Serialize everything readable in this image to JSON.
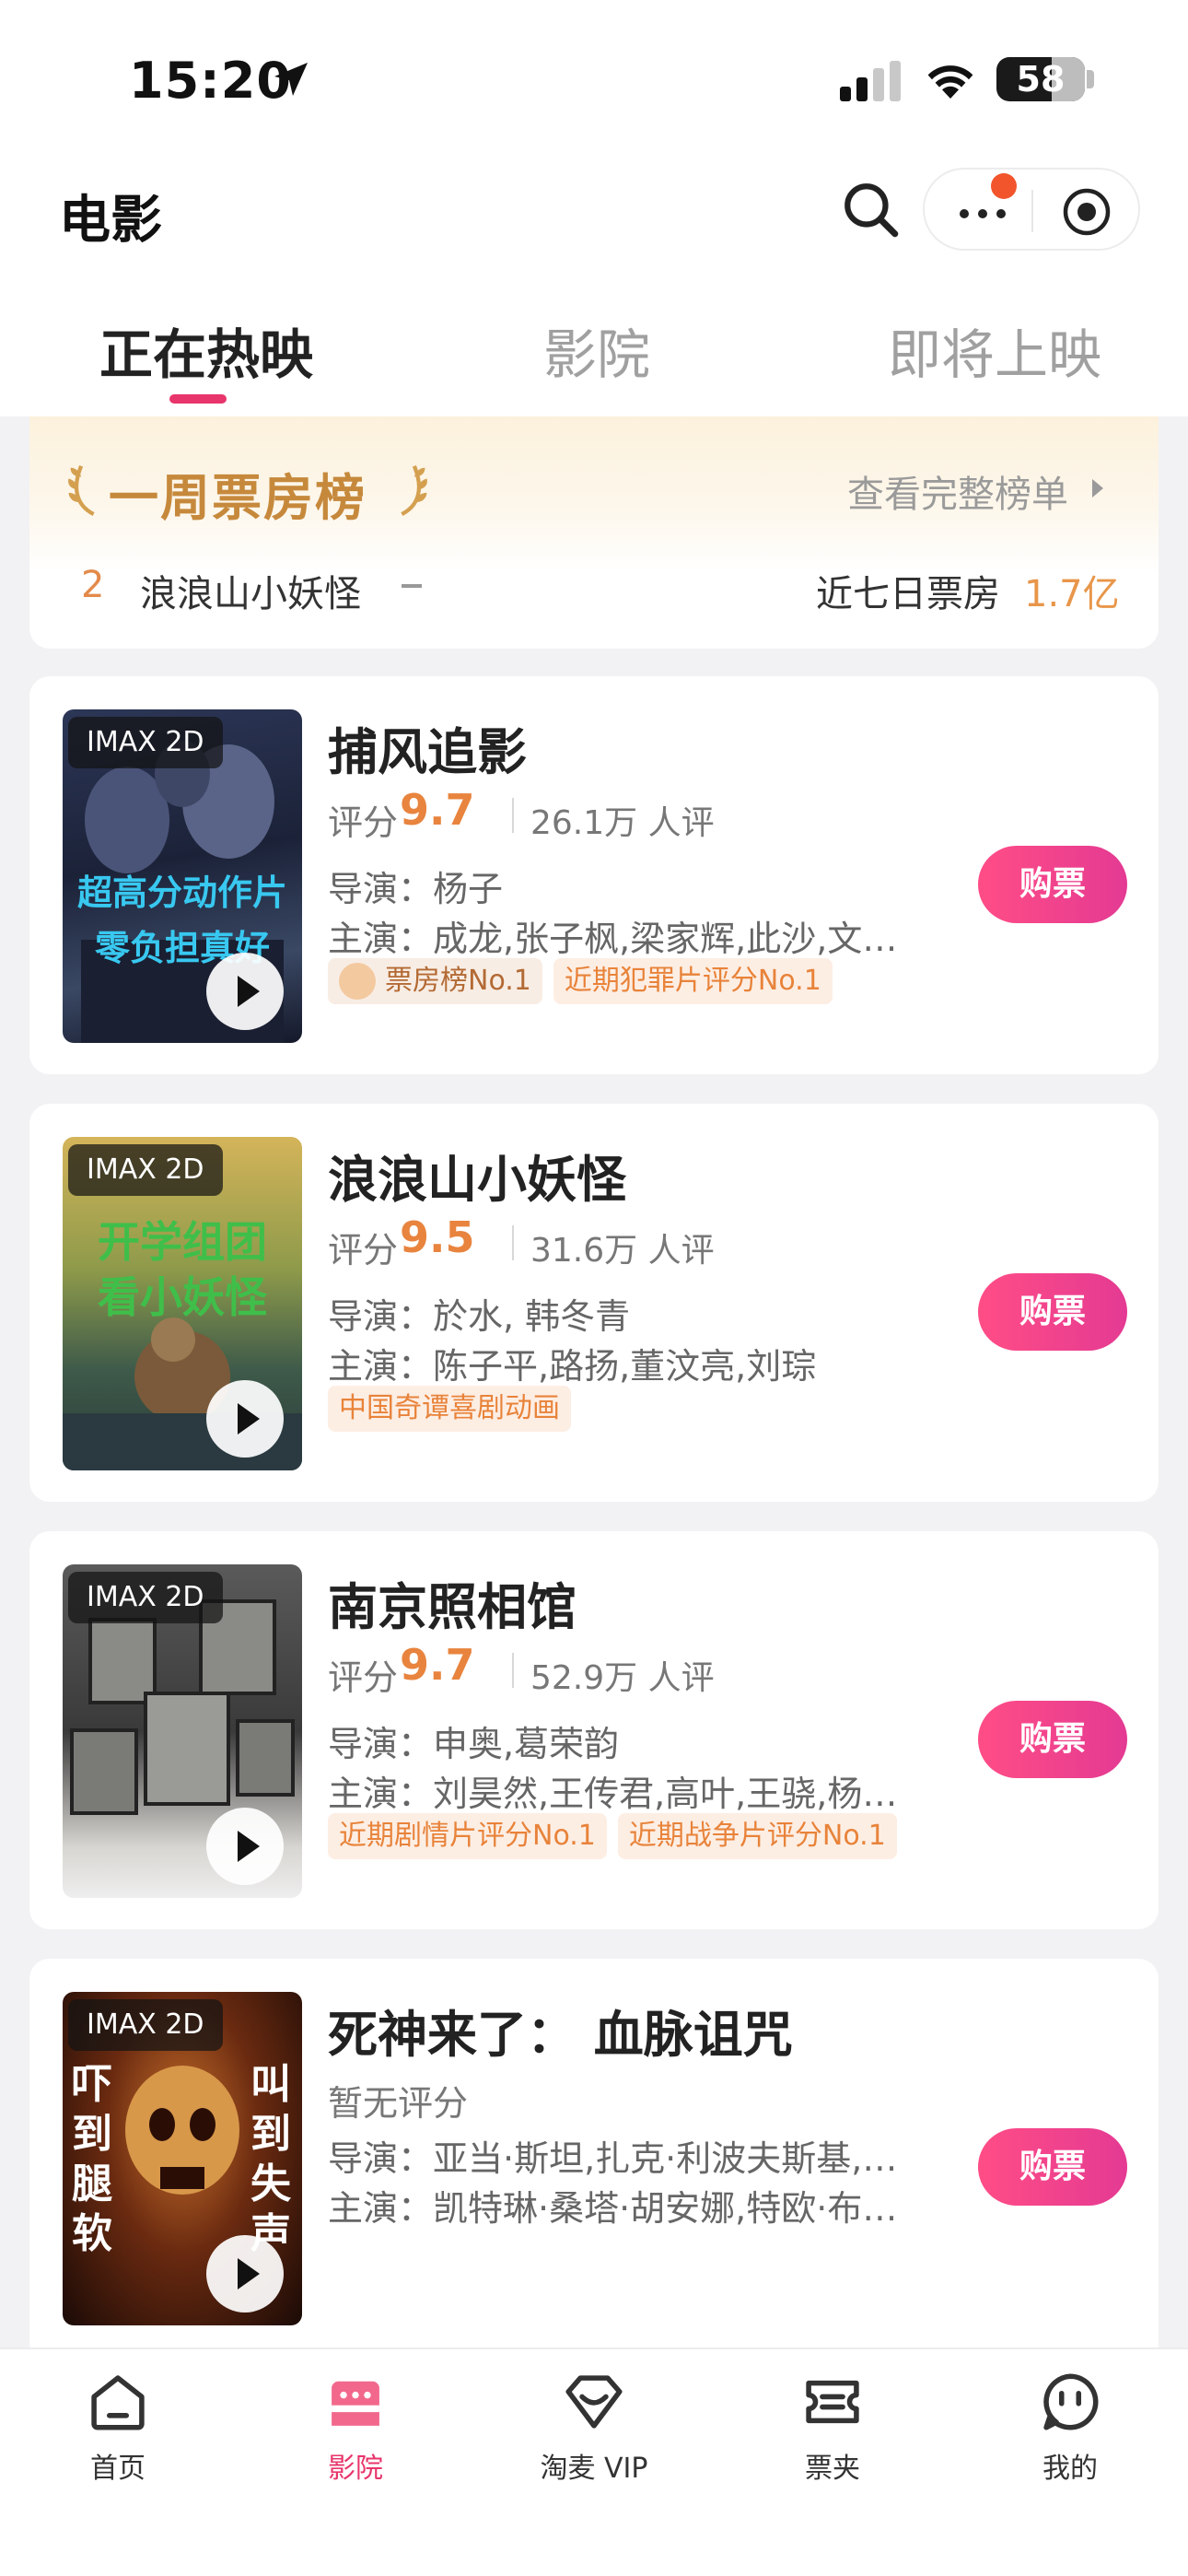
{
  "status_bar": {
    "time": "15:20",
    "battery": "58"
  },
  "header": {
    "title": "电影"
  },
  "tabs": [
    {
      "label": "正在热映",
      "active": true
    },
    {
      "label": "影院",
      "active": false
    },
    {
      "label": "即将上映",
      "active": false
    }
  ],
  "ranking": {
    "title": "一周票房榜",
    "more_label": "查看完整榜单",
    "row": {
      "rank": "2",
      "name": "浪浪山小妖怪",
      "metric_label": "近七日票房",
      "metric_value": "1.7亿"
    }
  },
  "buy_label": "购票",
  "score_label": "评分",
  "movies": [
    {
      "badge": "IMAX 2D",
      "poster_text": [
        "超高分动作片",
        "零负担真好"
      ],
      "title": "捕风追影",
      "score": "9.7",
      "rating_count": "26.1万 人评",
      "director": "导演：杨子",
      "cast": "主演：成龙,张子枫,梁家辉,此沙,文俊...",
      "tags": [
        "票房榜No.1",
        "近期犯罪片评分No.1"
      ]
    },
    {
      "badge": "IMAX 2D",
      "poster_text": [
        "开学组团",
        "看小妖怪"
      ],
      "title": "浪浪山小妖怪",
      "score": "9.5",
      "rating_count": "31.6万 人评",
      "director": "导演：於水, 韩冬青",
      "cast": "主演：陈子平,路扬,董汶亮,刘琮",
      "tags": [
        "中国奇谭喜剧动画"
      ]
    },
    {
      "badge": "IMAX 2D",
      "poster_text": [],
      "title": "南京照相馆",
      "score": "9.7",
      "rating_count": "52.9万 人评",
      "director": "导演：申奥,葛荣韵",
      "cast": "主演：刘昊然,王传君,高叶,王骁,杨恩...",
      "tags": [
        "近期剧情片评分No.1",
        "近期战争片评分No.1"
      ]
    },
    {
      "badge": "IMAX 2D",
      "poster_text": [
        "吓到腿软",
        "叫到失声"
      ],
      "title": "死神来了：  血脉诅咒",
      "no_score": "暂无评分",
      "director": "导演：亚当·斯坦,扎克·利波夫斯基,瑞...",
      "cast": "主演：凯特琳·桑塔·胡安娜,特欧·布里...",
      "tags": []
    }
  ],
  "bottom_nav": [
    {
      "label": "首页",
      "icon": "home-icon",
      "active": false
    },
    {
      "label": "影院",
      "icon": "cinema-icon",
      "active": true
    },
    {
      "label": "淘麦 VIP",
      "icon": "vip-icon",
      "active": false
    },
    {
      "label": "票夹",
      "icon": "ticket-icon",
      "active": false
    },
    {
      "label": "我的",
      "icon": "profile-icon",
      "active": false
    }
  ],
  "colors": {
    "accent": "#e8356b",
    "score": "#e8843e",
    "gold": "#c6893c"
  }
}
